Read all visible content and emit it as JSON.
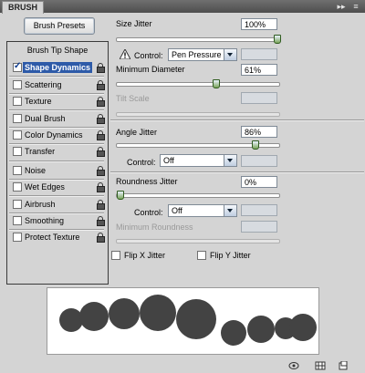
{
  "panel": {
    "tab_label": "BRUSH",
    "collapse_icon": "double-arrow-icon",
    "menu_icon": "panel-menu-icon"
  },
  "presets_button": "Brush Presets",
  "tip_header": "Brush Tip Shape",
  "options": [
    {
      "label": "Shape Dynamics",
      "checked": true,
      "selected": true
    },
    {
      "label": "Scattering",
      "checked": false
    },
    {
      "label": "Texture",
      "checked": false
    },
    {
      "label": "Dual Brush",
      "checked": false
    },
    {
      "label": "Color Dynamics",
      "checked": false
    },
    {
      "label": "Transfer",
      "checked": false
    },
    {
      "label": "Noise",
      "checked": false
    },
    {
      "label": "Wet Edges",
      "checked": false
    },
    {
      "label": "Airbrush",
      "checked": false
    },
    {
      "label": "Smoothing",
      "checked": false
    },
    {
      "label": "Protect Texture",
      "checked": false
    }
  ],
  "size_jitter": {
    "label": "Size Jitter",
    "value": "100%",
    "level": 1.0
  },
  "size_control": {
    "label": "Control:",
    "value": "Pen Pressure"
  },
  "min_diameter": {
    "label": "Minimum Diameter",
    "value": "61%",
    "level": 0.61
  },
  "tilt_scale": {
    "label": "Tilt Scale"
  },
  "angle_jitter": {
    "label": "Angle Jitter",
    "value": "86%",
    "level": 0.86
  },
  "angle_control": {
    "label": "Control:",
    "value": "Off"
  },
  "roundness_jitter": {
    "label": "Roundness Jitter",
    "value": "0%",
    "level": 0.0
  },
  "roundness_control": {
    "label": "Control:",
    "value": "Off"
  },
  "min_roundness": {
    "label": "Minimum Roundness"
  },
  "flip_x": {
    "label": "Flip X Jitter",
    "checked": false
  },
  "flip_y": {
    "label": "Flip Y Jitter",
    "checked": false
  },
  "colors": {
    "selection": "#2d5aa8",
    "dab": "#434343"
  },
  "bottom_icons": [
    "brush-toggle-icon",
    "grid-icon",
    "new-preset-icon"
  ]
}
